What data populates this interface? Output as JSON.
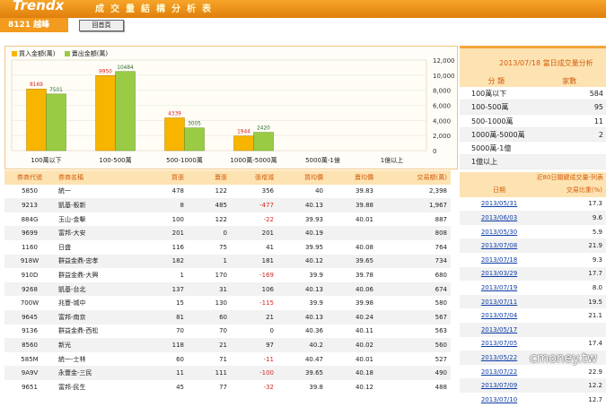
{
  "app": {
    "brand": "Trendx",
    "page_title": "成交量結構分析表",
    "stock_code": "8121 越峰",
    "query_button": "回首頁"
  },
  "chart": {
    "legend": [
      {
        "label": "買入金額(萬)",
        "color": "#f7b500"
      },
      {
        "label": "賣出金額(萬)",
        "color": "#99cc44"
      }
    ],
    "categories": [
      "100萬以下",
      "100-500萬",
      "500-1000萬",
      "1000萬-5000萬",
      "5000萬-1億",
      "1億以上"
    ],
    "buy": [
      8169,
      9950,
      4339,
      1944,
      0,
      0
    ],
    "sell": [
      7501,
      10484,
      3005,
      2420,
      0,
      0
    ],
    "ytick_labels": [
      "12,000",
      "10,000",
      "8,000",
      "6,000",
      "4,000",
      "2,000",
      "0"
    ]
  },
  "chart_data": {
    "type": "bar",
    "categories": [
      "100萬以下",
      "100-500萬",
      "500-1000萬",
      "1000萬-5000萬",
      "5000萬-1億",
      "1億以上"
    ],
    "series": [
      {
        "name": "買入金額(萬)",
        "values": [
          8169,
          9950,
          4339,
          1944,
          0,
          0
        ]
      },
      {
        "name": "賣出金額(萬)",
        "values": [
          7501,
          10484,
          3005,
          2420,
          0,
          0
        ]
      }
    ],
    "ylim": [
      0,
      12000
    ]
  },
  "summary": {
    "title": "2013/07/18 當日成交量分析",
    "headers": [
      "分 類",
      "家數"
    ],
    "rows": [
      [
        "100萬以下",
        "584"
      ],
      [
        "100-500萬",
        "95"
      ],
      [
        "500-1000萬",
        "11"
      ],
      [
        "1000萬-5000萬",
        "2"
      ],
      [
        "5000萬-1億",
        ""
      ],
      [
        "1億以上",
        ""
      ]
    ]
  },
  "history": {
    "header": "近80日關鍵成交量-列表",
    "columns": [
      "日期",
      "交易比重(%)"
    ],
    "rows": [
      [
        "2013/05/31",
        "17.3"
      ],
      [
        "2013/06/03",
        "9.6"
      ],
      [
        "2013/05/30",
        "5.9"
      ],
      [
        "2013/07/08",
        "21.9"
      ],
      [
        "2013/07/18",
        "9.3"
      ],
      [
        "2013/03/29",
        "17.7"
      ],
      [
        "2013/07/19",
        "8.0"
      ],
      [
        "2013/07/11",
        "19.5"
      ],
      [
        "2013/07/04",
        "21.1"
      ],
      [
        "2013/05/17",
        ""
      ],
      [
        "2013/07/05",
        "17.4"
      ],
      [
        "2013/05/22",
        ""
      ],
      [
        "2013/07/22",
        "22.9"
      ],
      [
        "2013/07/09",
        "12.2"
      ],
      [
        "2013/07/10",
        "12.7"
      ]
    ]
  },
  "brokers": {
    "columns": [
      "券商代號",
      "券商名稱",
      "買張",
      "賣張",
      "張增減",
      "買均價",
      "賣均價",
      "交易額(萬)"
    ],
    "rows": [
      [
        "5850",
        "統一",
        "478",
        "122",
        "356",
        "40",
        "39.83",
        "2,398"
      ],
      [
        "9213",
        "凱基-板新",
        "8",
        "485",
        "-477",
        "40.13",
        "39.88",
        "1,967"
      ],
      [
        "884G",
        "玉山-金擊",
        "100",
        "122",
        "-22",
        "39.93",
        "40.01",
        "887"
      ],
      [
        "9699",
        "富邦-大安",
        "201",
        "0",
        "201",
        "40.19",
        "",
        "808"
      ],
      [
        "1160",
        "日盛",
        "116",
        "75",
        "41",
        "39.95",
        "40.08",
        "764"
      ],
      [
        "918W",
        "群益金鼎-忠孝",
        "182",
        "1",
        "181",
        "40.12",
        "39.65",
        "734"
      ],
      [
        "910D",
        "群益金鼎-大興",
        "1",
        "170",
        "-169",
        "39.9",
        "39.78",
        "680"
      ],
      [
        "9268",
        "凱基-台北",
        "137",
        "31",
        "106",
        "40.13",
        "40.06",
        "674"
      ],
      [
        "700W",
        "兆豐-城中",
        "15",
        "130",
        "-115",
        "39.9",
        "39.98",
        "580"
      ],
      [
        "9645",
        "富邦-南京",
        "81",
        "60",
        "21",
        "40.13",
        "40.24",
        "567"
      ],
      [
        "9136",
        "群益金鼎-西松",
        "70",
        "70",
        "0",
        "40.36",
        "40.11",
        "563"
      ],
      [
        "8560",
        "新光",
        "118",
        "21",
        "97",
        "40.2",
        "40.02",
        "560"
      ],
      [
        "585M",
        "統一-士林",
        "60",
        "71",
        "-11",
        "40.47",
        "40.01",
        "527"
      ],
      [
        "9A9V",
        "永豐金-三民",
        "11",
        "111",
        "-100",
        "39.65",
        "40.18",
        "490"
      ],
      [
        "9651",
        "富邦-民生",
        "45",
        "77",
        "-32",
        "39.8",
        "40.12",
        "488"
      ]
    ]
  },
  "watermark": "cmoney.tw"
}
